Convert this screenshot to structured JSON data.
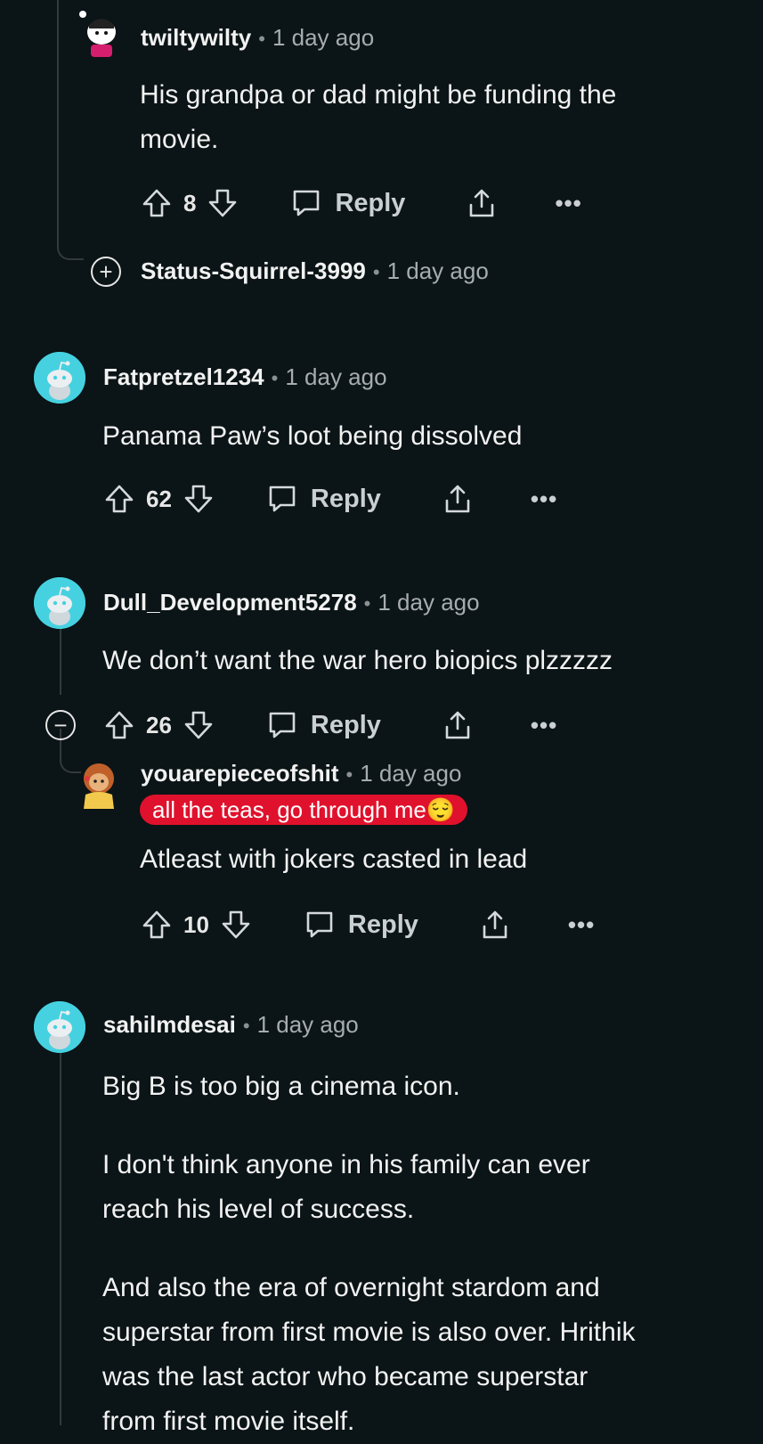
{
  "comments": [
    {
      "username": "twiltywilty",
      "time": "1 day ago",
      "body": [
        "His grandpa or dad might be funding the",
        "movie."
      ],
      "votes": "8",
      "reply_label": "Reply"
    },
    {
      "username": "Status-Squirrel-3999",
      "time": "1 day ago",
      "collapsed": true
    },
    {
      "username": "Fatpretzel1234",
      "time": "1 day ago",
      "body": [
        "Panama Paw’s loot being dissolved"
      ],
      "votes": "62",
      "reply_label": "Reply"
    },
    {
      "username": "Dull_Development5278",
      "time": "1 day ago",
      "body": [
        "We don’t want the war hero biopics plzzzzz"
      ],
      "votes": "26",
      "reply_label": "Reply"
    },
    {
      "username": "youarepieceofshit",
      "time": "1 day ago",
      "flair": "all the teas, go through me😌",
      "body": [
        "Atleast with jokers casted in lead"
      ],
      "votes": "10",
      "reply_label": "Reply"
    },
    {
      "username": "sahilmdesai",
      "time": "1 day ago",
      "body": [
        "Big B is too big a cinema icon.",
        "I don't think anyone in his family can ever",
        "reach his level of success.",
        "And also the era of overnight stardom and",
        "superstar from first movie is also over. Hrithik",
        "was the last actor who became superstar",
        "from first movie itself."
      ]
    }
  ],
  "symbols": {
    "separator": "•",
    "more": "•••",
    "expand": "+",
    "collapse": "−"
  },
  "colors": {
    "background": "#0b1416",
    "snoo_avatar": "#46d1e0",
    "flair": "#e0112c",
    "thread_line": "#33393c"
  }
}
